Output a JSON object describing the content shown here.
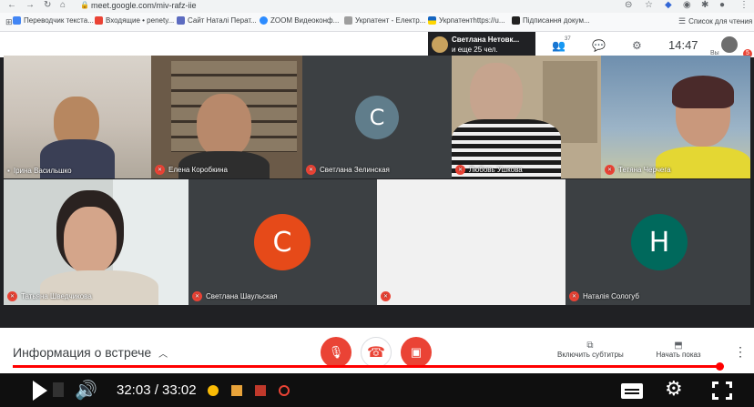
{
  "browser": {
    "url": "meet.google.com/miv-rafz-iie",
    "bookmarks": [
      {
        "label": "Переводчик текста...",
        "color": "#4285f4"
      },
      {
        "label": "Входящие • penety...",
        "color": "#ea4335"
      },
      {
        "label": "Сайт Наталі Перат...",
        "color": "#5c6bc0"
      },
      {
        "label": "ZOOM Видеоконф...",
        "color": "#2d8cff"
      },
      {
        "label": "Укрпатент - Електр...",
        "color": "#9e9e9e"
      },
      {
        "label": "Укрпатентhttps://u...",
        "color": "#ffd600"
      },
      {
        "label": "Підписання докум...",
        "color": "#212121"
      }
    ],
    "reading_list": "Список для чтения"
  },
  "meet_header": {
    "presenter_name": "Светлана Нетовк...",
    "others": "и еще 25 чел.",
    "people_count": "37",
    "time": "14:47",
    "you_label": "Вы",
    "notif_count": "5"
  },
  "participants": [
    {
      "name": "Ірина Васильшко",
      "muted": false
    },
    {
      "name": "Елена Коробкина",
      "muted": true
    },
    {
      "name": "Светлана Зелинская",
      "muted": true,
      "initial": "С",
      "avatar_color": "#607d8b"
    },
    {
      "name": "Любовь Ушкова",
      "muted": true
    },
    {
      "name": "Тетяна Черчега",
      "muted": true
    },
    {
      "name": "Татьяна Шведчикова",
      "muted": true
    },
    {
      "name": "Светлана Шаульская",
      "muted": true,
      "initial": "С",
      "avatar_color": "#e64a19"
    },
    {
      "name": "",
      "muted": true
    },
    {
      "name": "Наталія Сологуб",
      "muted": true,
      "initial": "Н",
      "avatar_color": "#00695c"
    }
  ],
  "bottom": {
    "meeting_info": "Информация о встрече",
    "captions": "Включить субтитры",
    "present": "Начать показ"
  },
  "player": {
    "time": "32:03 / 33:02",
    "progress": 0.97
  },
  "colors": {
    "accent_red": "#ea4335",
    "yt_red": "#ff0000"
  }
}
